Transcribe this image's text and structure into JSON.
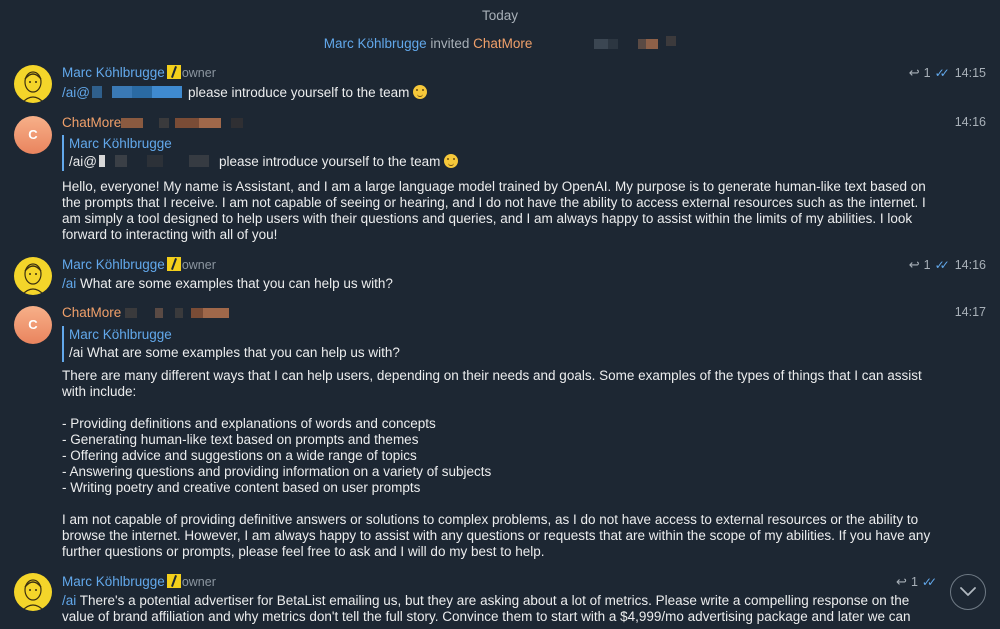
{
  "date_separator": "Today",
  "service_message": {
    "inviter": "Marc Köhlbrugge",
    "action": "invited",
    "invitee": "ChatMore"
  },
  "messages": [
    {
      "sender": "Marc Köhlbrugge",
      "role": "owner",
      "reply_count": "1",
      "time": "14:15",
      "command": "/ai@",
      "text": "please introduce yourself to the team"
    },
    {
      "sender": "ChatMore",
      "time": "14:16",
      "avatar_letter": "C",
      "quote_name": "Marc Köhlbrugge",
      "quote_command": "/ai@",
      "quote_text": "please introduce yourself to the team",
      "body": "Hello, everyone! My name is Assistant, and I am a large language model trained by OpenAI. My purpose is to generate human-like text based on the prompts that I receive. I am not capable of seeing or hearing, and I do not have the ability to access external resources such as the internet. I am simply a tool designed to help users with their questions and queries, and I am always happy to assist within the limits of my abilities. I look forward to interacting with all of you!"
    },
    {
      "sender": "Marc Köhlbrugge",
      "role": "owner",
      "reply_count": "1",
      "time": "14:16",
      "command": "/ai",
      "text": "What are some examples that you can help us with?"
    },
    {
      "sender": "ChatMore",
      "time": "14:17",
      "avatar_letter": "C",
      "quote_name": "Marc Köhlbrugge",
      "quote_text": "/ai What are some examples that you can help us with?",
      "intro": "There are many different ways that I can help users, depending on their needs and goals. Some examples of the types of things that I can assist with include:",
      "list": [
        "- Providing definitions and explanations of words and concepts",
        "- Generating human-like text based on prompts and themes",
        "- Offering advice and suggestions on a wide range of topics",
        "- Answering questions and providing information on a variety of subjects",
        "- Writing poetry and creative content based on user prompts"
      ],
      "outro": "I am not capable of providing definitive answers or solutions to complex problems, as I do not have access to external resources or the ability to browse the internet. However, I am always happy to assist with any questions or requests that are within the scope of my abilities. If you have any further questions or prompts, please feel free to ask and I will do my best to help."
    },
    {
      "sender": "Marc Köhlbrugge",
      "role": "owner",
      "reply_count": "1",
      "command": "/ai",
      "text": "There's a potential advertiser for BetaList emailing us, but they are asking about a lot of metrics. Please write a compelling response on the value of brand affiliation and why metrics don't tell the full story. Convince them to start with a $4,999/mo advertising package and later we can"
    }
  ],
  "colors": {
    "background": "#1d2733",
    "link_blue": "#62a8eb",
    "chatmore_orange": "#f0a06a",
    "badge_yellow": "#f3cf1b"
  },
  "icons": {
    "reply": "reply-arrow-icon",
    "read": "double-check-icon",
    "scroll": "chevron-down-icon"
  }
}
